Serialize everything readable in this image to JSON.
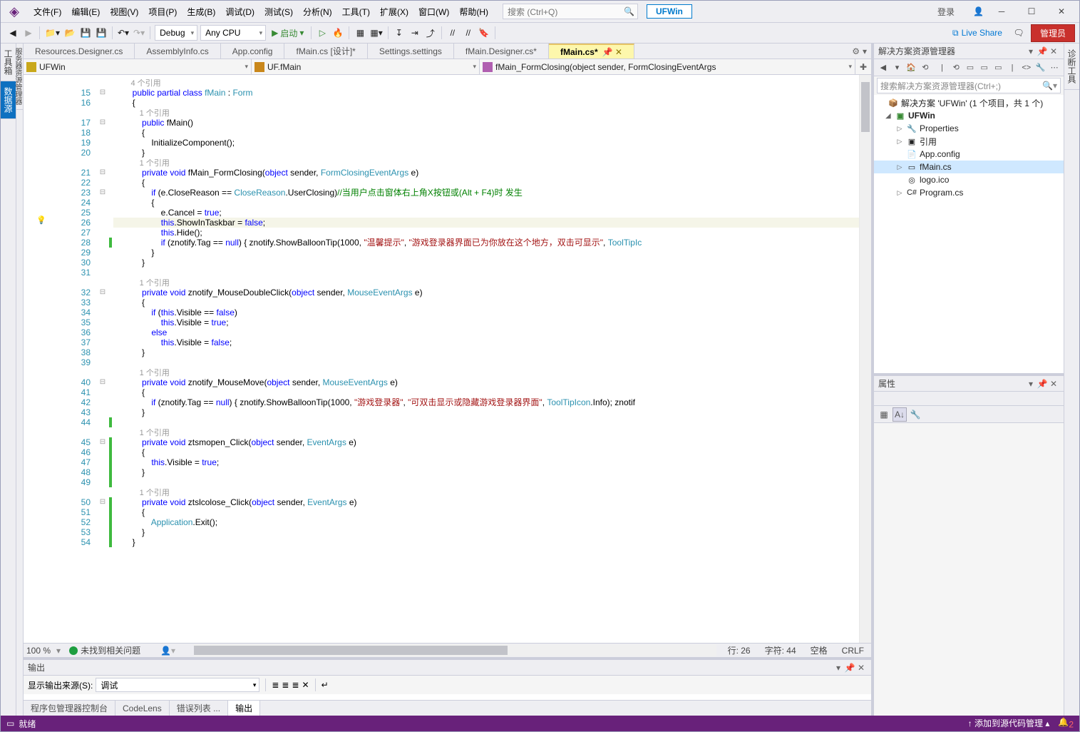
{
  "menu": {
    "file": "文件(F)",
    "edit": "编辑(E)",
    "view": "视图(V)",
    "project": "项目(P)",
    "build": "生成(B)",
    "debug": "调试(D)",
    "test": "测试(S)",
    "analyze": "分析(N)",
    "tools": "工具(T)",
    "extensions": "扩展(X)",
    "window": "窗口(W)",
    "help": "帮助(H)"
  },
  "search_placeholder": "搜索 (Ctrl+Q)",
  "badge": "UFWin",
  "login": "登录",
  "toolbar": {
    "config": "Debug",
    "platform": "Any CPU",
    "start": "启动"
  },
  "liveshare": "Live Share",
  "admin": "管理员",
  "tabs": [
    "Resources.Designer.cs",
    "AssemblyInfo.cs",
    "App.config",
    "fMain.cs [设计]*",
    "Settings.settings",
    "fMain.Designer.cs*",
    "fMain.cs*"
  ],
  "active_tab_index": 6,
  "nav": {
    "ns": "UFWin",
    "cls": "UF.fMain",
    "member": "fMain_FormClosing(object sender, FormClosingEventArgs"
  },
  "code": {
    "ref": " 个引用",
    "lines": [
      {
        "n": "",
        "indent": 8,
        "ref": "4"
      },
      {
        "n": 15,
        "fold": "⊟",
        "t": [
          [
            "kw",
            "public"
          ],
          [
            "",
            " "
          ],
          [
            "kw",
            "partial"
          ],
          [
            "",
            " "
          ],
          [
            "kw",
            "class"
          ],
          [
            "",
            " "
          ],
          [
            "type",
            "fMain"
          ],
          [
            "",
            " : "
          ],
          [
            "type",
            "Form"
          ]
        ]
      },
      {
        "n": 16,
        "t": [
          [
            "",
            "{"
          ]
        ]
      },
      {
        "n": "",
        "indent": 12,
        "ref": "1"
      },
      {
        "n": 17,
        "fold": "⊟",
        "t": [
          [
            "",
            "    "
          ],
          [
            "kw",
            "public"
          ],
          [
            "",
            " fMain()"
          ]
        ]
      },
      {
        "n": 18,
        "t": [
          [
            "",
            "    {"
          ]
        ]
      },
      {
        "n": 19,
        "t": [
          [
            "",
            "        InitializeComponent();"
          ]
        ]
      },
      {
        "n": 20,
        "t": [
          [
            "",
            "    }"
          ]
        ]
      },
      {
        "n": "",
        "indent": 12,
        "ref": "1"
      },
      {
        "n": 21,
        "fold": "⊟",
        "t": [
          [
            "",
            "    "
          ],
          [
            "kw",
            "private"
          ],
          [
            "",
            " "
          ],
          [
            "kw",
            "void"
          ],
          [
            "",
            " fMain_FormClosing("
          ],
          [
            "kw",
            "object"
          ],
          [
            "",
            " sender, "
          ],
          [
            "type",
            "FormClosingEventArgs"
          ],
          [
            "",
            " e)"
          ]
        ]
      },
      {
        "n": 22,
        "t": [
          [
            "",
            "    {"
          ]
        ]
      },
      {
        "n": 23,
        "fold": "⊟",
        "t": [
          [
            "",
            "        "
          ],
          [
            "kw",
            "if"
          ],
          [
            "",
            " (e.CloseReason == "
          ],
          [
            "type",
            "CloseReason"
          ],
          [
            "",
            ".UserClosing)"
          ],
          [
            "cmt",
            "//当用户点击窗体右上角X按钮或(Alt + F4)时 发生"
          ]
        ]
      },
      {
        "n": 24,
        "t": [
          [
            "",
            "        {"
          ]
        ]
      },
      {
        "n": 25,
        "t": [
          [
            "",
            "            e.Cancel = "
          ],
          [
            "kw",
            "true"
          ],
          [
            "",
            ";"
          ]
        ]
      },
      {
        "n": 26,
        "hl": true,
        "bulb": true,
        "t": [
          [
            "",
            "            "
          ],
          [
            "kw",
            "this"
          ],
          [
            "",
            ".ShowInTaskbar = "
          ],
          [
            "kw",
            "false"
          ],
          [
            "",
            ";"
          ]
        ]
      },
      {
        "n": 27,
        "t": [
          [
            "",
            "            "
          ],
          [
            "kw",
            "this"
          ],
          [
            "",
            ".Hide();"
          ]
        ]
      },
      {
        "n": 28,
        "ind": "g",
        "t": [
          [
            "",
            "            "
          ],
          [
            "kw",
            "if"
          ],
          [
            "",
            " (znotify.Tag == "
          ],
          [
            "kw",
            "null"
          ],
          [
            "",
            ") { znotify.ShowBalloonTip(1000, "
          ],
          [
            "str",
            "\"温馨提示\""
          ],
          [
            "",
            ", "
          ],
          [
            "str",
            "\"游戏登录器界面已为你放在这个地方，双击可显示\""
          ],
          [
            "",
            ", "
          ],
          [
            "type",
            "ToolTipIc"
          ]
        ]
      },
      {
        "n": 29,
        "t": [
          [
            "",
            "        }"
          ]
        ]
      },
      {
        "n": 30,
        "t": [
          [
            "",
            "    }"
          ]
        ]
      },
      {
        "n": 31,
        "t": [
          [
            "",
            ""
          ]
        ]
      },
      {
        "n": "",
        "indent": 12,
        "ref": "1"
      },
      {
        "n": 32,
        "fold": "⊟",
        "t": [
          [
            "",
            "    "
          ],
          [
            "kw",
            "private"
          ],
          [
            "",
            " "
          ],
          [
            "kw",
            "void"
          ],
          [
            "",
            " znotify_MouseDoubleClick("
          ],
          [
            "kw",
            "object"
          ],
          [
            "",
            " sender, "
          ],
          [
            "type",
            "MouseEventArgs"
          ],
          [
            "",
            " e)"
          ]
        ]
      },
      {
        "n": 33,
        "t": [
          [
            "",
            "    {"
          ]
        ]
      },
      {
        "n": 34,
        "t": [
          [
            "",
            "        "
          ],
          [
            "kw",
            "if"
          ],
          [
            "",
            " ("
          ],
          [
            "kw",
            "this"
          ],
          [
            "",
            ".Visible == "
          ],
          [
            "kw",
            "false"
          ],
          [
            "",
            ")"
          ]
        ]
      },
      {
        "n": 35,
        "t": [
          [
            "",
            "            "
          ],
          [
            "kw",
            "this"
          ],
          [
            "",
            ".Visible = "
          ],
          [
            "kw",
            "true"
          ],
          [
            "",
            ";"
          ]
        ]
      },
      {
        "n": 36,
        "t": [
          [
            "",
            "        "
          ],
          [
            "kw",
            "else"
          ]
        ]
      },
      {
        "n": 37,
        "t": [
          [
            "",
            "            "
          ],
          [
            "kw",
            "this"
          ],
          [
            "",
            ".Visible = "
          ],
          [
            "kw",
            "false"
          ],
          [
            "",
            ";"
          ]
        ]
      },
      {
        "n": 38,
        "t": [
          [
            "",
            "    }"
          ]
        ]
      },
      {
        "n": 39,
        "t": [
          [
            "",
            ""
          ]
        ]
      },
      {
        "n": "",
        "indent": 12,
        "ref": "1"
      },
      {
        "n": 40,
        "fold": "⊟",
        "t": [
          [
            "",
            "    "
          ],
          [
            "kw",
            "private"
          ],
          [
            "",
            " "
          ],
          [
            "kw",
            "void"
          ],
          [
            "",
            " znotify_MouseMove("
          ],
          [
            "kw",
            "object"
          ],
          [
            "",
            " sender, "
          ],
          [
            "type",
            "MouseEventArgs"
          ],
          [
            "",
            " e)"
          ]
        ]
      },
      {
        "n": 41,
        "t": [
          [
            "",
            "    {"
          ]
        ]
      },
      {
        "n": 42,
        "t": [
          [
            "",
            "        "
          ],
          [
            "kw",
            "if"
          ],
          [
            "",
            " (znotify.Tag == "
          ],
          [
            "kw",
            "null"
          ],
          [
            "",
            ") { znotify.ShowBalloonTip(1000, "
          ],
          [
            "str",
            "\"游戏登录器\""
          ],
          [
            "",
            ", "
          ],
          [
            "str",
            "\"可双击显示或隐藏游戏登录器界面\""
          ],
          [
            "",
            ", "
          ],
          [
            "type",
            "ToolTipIcon"
          ],
          [
            "",
            ".Info); znotif"
          ]
        ]
      },
      {
        "n": 43,
        "t": [
          [
            "",
            "    }"
          ]
        ]
      },
      {
        "n": 44,
        "ind": "g",
        "t": [
          [
            "",
            ""
          ]
        ]
      },
      {
        "n": "",
        "indent": 12,
        "ref": "1"
      },
      {
        "n": 45,
        "fold": "⊟",
        "ind": "g",
        "t": [
          [
            "",
            "    "
          ],
          [
            "kw",
            "private"
          ],
          [
            "",
            " "
          ],
          [
            "kw",
            "void"
          ],
          [
            "",
            " ztsmopen_Click("
          ],
          [
            "kw",
            "object"
          ],
          [
            "",
            " sender, "
          ],
          [
            "type",
            "EventArgs"
          ],
          [
            "",
            " e)"
          ]
        ]
      },
      {
        "n": 46,
        "ind": "g",
        "t": [
          [
            "",
            "    {"
          ]
        ]
      },
      {
        "n": 47,
        "ind": "g",
        "t": [
          [
            "",
            "        "
          ],
          [
            "kw",
            "this"
          ],
          [
            "",
            ".Visible = "
          ],
          [
            "kw",
            "true"
          ],
          [
            "",
            ";"
          ]
        ]
      },
      {
        "n": 48,
        "ind": "g",
        "t": [
          [
            "",
            "    }"
          ]
        ]
      },
      {
        "n": 49,
        "ind": "g",
        "t": [
          [
            "",
            ""
          ]
        ]
      },
      {
        "n": "",
        "indent": 12,
        "ref": "1"
      },
      {
        "n": 50,
        "fold": "⊟",
        "ind": "g",
        "t": [
          [
            "",
            "    "
          ],
          [
            "kw",
            "private"
          ],
          [
            "",
            " "
          ],
          [
            "kw",
            "void"
          ],
          [
            "",
            " ztslcolose_Click("
          ],
          [
            "kw",
            "object"
          ],
          [
            "",
            " sender, "
          ],
          [
            "type",
            "EventArgs"
          ],
          [
            "",
            " e)"
          ]
        ]
      },
      {
        "n": 51,
        "ind": "g",
        "t": [
          [
            "",
            "    {"
          ]
        ]
      },
      {
        "n": 52,
        "ind": "g",
        "t": [
          [
            "",
            "        "
          ],
          [
            "type",
            "Application"
          ],
          [
            "",
            ".Exit();"
          ]
        ]
      },
      {
        "n": 53,
        "ind": "g",
        "t": [
          [
            "",
            "    }"
          ]
        ]
      },
      {
        "n": 54,
        "ind": "g",
        "t": [
          [
            "",
            "}"
          ]
        ]
      },
      {
        "n": "",
        "t": [
          [
            "",
            ""
          ]
        ]
      }
    ]
  },
  "editor_status": {
    "zoom": "100 %",
    "noissue": "未找到相关问题",
    "line": "行: 26",
    "col": "字符: 44",
    "ins": "空格",
    "crlf": "CRLF"
  },
  "output": {
    "title": "输出",
    "src_label": "显示输出来源(S):",
    "src_value": "调试"
  },
  "bottom_tabs": [
    "程序包管理器控制台",
    "CodeLens",
    "错误列表 ...",
    "输出"
  ],
  "bottom_active": 3,
  "solexp": {
    "title": "解决方案资源管理器",
    "search": "搜索解决方案资源管理器(Ctrl+;)",
    "root": "解决方案 'UFWin' (1 个项目，共 1 个)",
    "project": "UFWin",
    "items": [
      {
        "l": "Properties",
        "exp": "▷",
        "ico": "🔧"
      },
      {
        "l": "引用",
        "exp": "▷",
        "ico": "▣"
      },
      {
        "l": "App.config",
        "ico": "📄"
      },
      {
        "l": "fMain.cs",
        "exp": "▷",
        "ico": "▭",
        "sel": true
      },
      {
        "l": "logo.ico",
        "ico": "◎"
      },
      {
        "l": "Program.cs",
        "exp": "▷",
        "ico": "C#"
      }
    ]
  },
  "props": {
    "title": "属性"
  },
  "left_rail": [
    "工具箱",
    "数据源"
  ],
  "left_rail2": [
    "服务器资源管理器"
  ],
  "right_rail": [
    "诊断工具"
  ],
  "status": {
    "ready": "就绪",
    "src_ctrl": "添加到源代码管理",
    "notif": "2"
  }
}
